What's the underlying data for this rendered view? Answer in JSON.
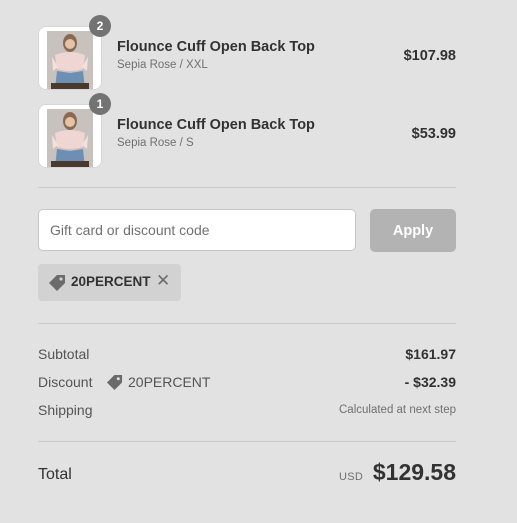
{
  "cart": {
    "items": [
      {
        "name": "Flounce Cuff Open Back Top",
        "variant": "Sepia Rose / XXL",
        "price": "$107.98",
        "quantity": "2"
      },
      {
        "name": "Flounce Cuff Open Back Top",
        "variant": "Sepia Rose / S",
        "price": "$53.99",
        "quantity": "1"
      }
    ]
  },
  "discount": {
    "placeholder": "Gift card or discount code",
    "value": "",
    "apply_label": "Apply",
    "applied_code": "20PERCENT",
    "remove_symbol": "✕"
  },
  "summary": {
    "subtotal_label": "Subtotal",
    "subtotal_value": "$161.97",
    "discount_label": "Discount",
    "discount_code": "20PERCENT",
    "discount_value": "- $32.39",
    "shipping_label": "Shipping",
    "shipping_value": "Calculated at next step",
    "total_label": "Total",
    "currency": "USD",
    "total_value": "$129.58"
  },
  "icons": {
    "discount_tag": "tag-icon",
    "remove": "close-icon"
  },
  "colors": {
    "background": "#e2e2e2",
    "apply_button": "#b3b3b3",
    "quantity_badge": "#737373",
    "tag_background": "#d2d2d2"
  }
}
